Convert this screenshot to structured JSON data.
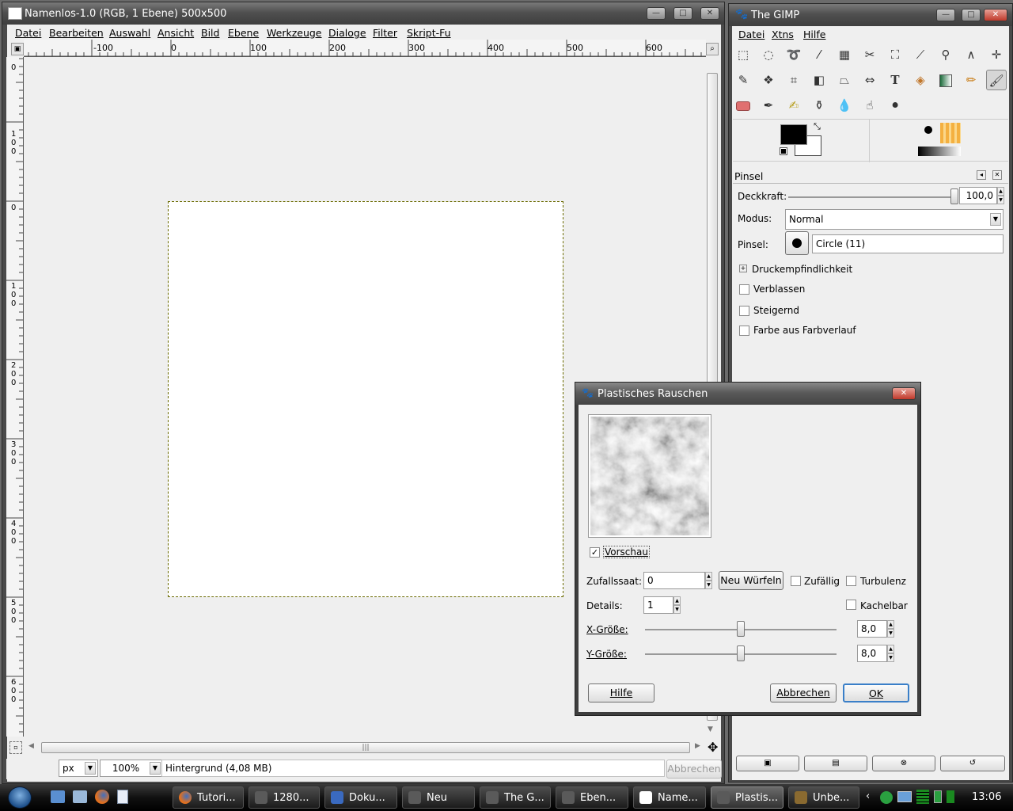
{
  "image_window": {
    "title": "Namenlos-1.0 (RGB, 1 Ebene) 500x500",
    "menu": [
      "Datei",
      "Bearbeiten",
      "Auswahl",
      "Ansicht",
      "Bild",
      "Ebene",
      "Werkzeuge",
      "Dialoge",
      "Filter",
      "Skript-Fu"
    ],
    "ruler_h_labels": [
      "-100",
      "0",
      "100",
      "200",
      "300",
      "400",
      "500",
      "600"
    ],
    "ruler_v_labels": [
      "0",
      "100",
      "0",
      "100",
      "200",
      "300",
      "400",
      "500",
      "600"
    ],
    "unit": "px",
    "zoom": "100%",
    "status": "Hintergrund (4,08 MB)",
    "cancel": "Abbrechen"
  },
  "toolbox": {
    "title": "The GIMP",
    "menu": [
      "Datei",
      "Xtns",
      "Hilfe"
    ],
    "tools": [
      "rect-select-icon",
      "ellipse-select-icon",
      "free-select-icon",
      "fuzzy-select-icon",
      "select-by-color-icon",
      "scissors-icon",
      "foreground-select-icon",
      "paths-icon",
      "color-picker-icon",
      "magnify-icon",
      "measure-icon",
      "move-icon",
      "crop-icon",
      "rotate-icon",
      "scale-icon",
      "shear-icon",
      "perspective-icon",
      "flip-icon",
      "text-icon",
      "bucket-fill-icon",
      "blend-icon",
      "pencil-icon",
      "paintbrush-icon",
      "eraser-icon",
      "airbrush-icon",
      "ink-icon",
      "clone-icon",
      "blur-icon",
      "smudge-icon",
      "dodge-burn-icon"
    ],
    "fg_color": "#000000",
    "bg_color": "#ffffff"
  },
  "tool_options": {
    "title": "Pinsel",
    "opacity_label": "Deckkraft:",
    "opacity_value": "100,0",
    "opacity_fraction": 1.0,
    "mode_label": "Modus:",
    "mode_value": "Normal",
    "brush_label": "Pinsel:",
    "brush_value": "Circle (11)",
    "pressure": "Druckempfindlichkeit",
    "checks": [
      "Verblassen",
      "Steigernd",
      "Farbe aus Farbverlauf"
    ]
  },
  "dialog": {
    "title": "Plastisches Rauschen",
    "preview_label": "Vorschau",
    "preview_checked": true,
    "seed_label": "Zufallssaat:",
    "seed_value": "0",
    "reroll": "Neu Würfeln",
    "random_label": "Zufällig",
    "turbulence_label": "Turbulenz",
    "details_label": "Details:",
    "details_value": "1",
    "tileable_label": "Kachelbar",
    "xsize_label": "X-Größe:",
    "xsize_value": "8,0",
    "ysize_label": "Y-Größe:",
    "ysize_value": "8,0",
    "size_fraction": 0.5,
    "help": "Hilfe",
    "cancel": "Abbrechen",
    "ok": "OK"
  },
  "taskbar": {
    "tasks": [
      "Tutori...",
      "1280...",
      "Doku...",
      "Neu",
      "The G...",
      "Eben...",
      "Name...",
      "Plastis...",
      "Unbe..."
    ],
    "active_index": 7,
    "clock": "13:06"
  }
}
